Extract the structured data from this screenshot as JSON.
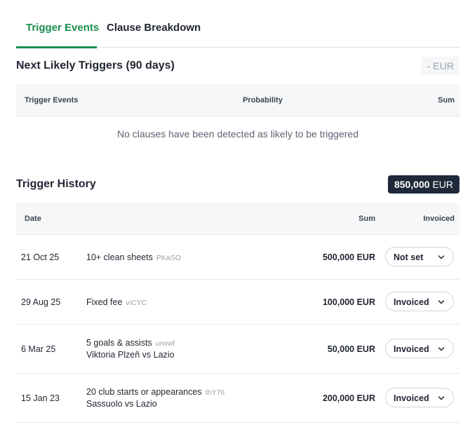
{
  "tabs": [
    {
      "label": "Trigger Events",
      "active": true
    },
    {
      "label": "Clause Breakdown",
      "active": false
    }
  ],
  "likely": {
    "title": "Next Likely Triggers (90 days)",
    "total": "- EUR",
    "columns": {
      "event": "Trigger Events",
      "probability": "Probability",
      "sum": "Sum"
    },
    "empty_message": "No clauses have been detected as likely to be triggered"
  },
  "history": {
    "title": "Trigger History",
    "total_amount": "850,000",
    "total_currency": "EUR",
    "columns": {
      "date": "Date",
      "sum": "Sum",
      "invoiced": "Invoiced"
    },
    "rows": [
      {
        "date": "21 Oct 25",
        "event": "10+ clean sheets",
        "code": "PKaSO",
        "sub": "",
        "sum": "500,000 EUR",
        "status": "Not set"
      },
      {
        "date": "29 Aug 25",
        "event": "Fixed fee",
        "code": "viCYC",
        "sub": "",
        "sum": "100,000 EUR",
        "status": "Invoiced"
      },
      {
        "date": "6 Mar 25",
        "event": "5 goals & assists",
        "code": "urwwf",
        "sub": "Viktoria Plzeň vs Lazio",
        "sum": "50,000 EUR",
        "status": "Invoiced"
      },
      {
        "date": "15 Jan 23",
        "event": "20 club starts or appearances",
        "code": "thY76",
        "sub": "Sassuolo vs Lazio",
        "sum": "200,000 EUR",
        "status": "Invoiced"
      }
    ]
  },
  "colors": {
    "accent": "#1a8f4e",
    "dark_badge": "#1e2a3a"
  }
}
